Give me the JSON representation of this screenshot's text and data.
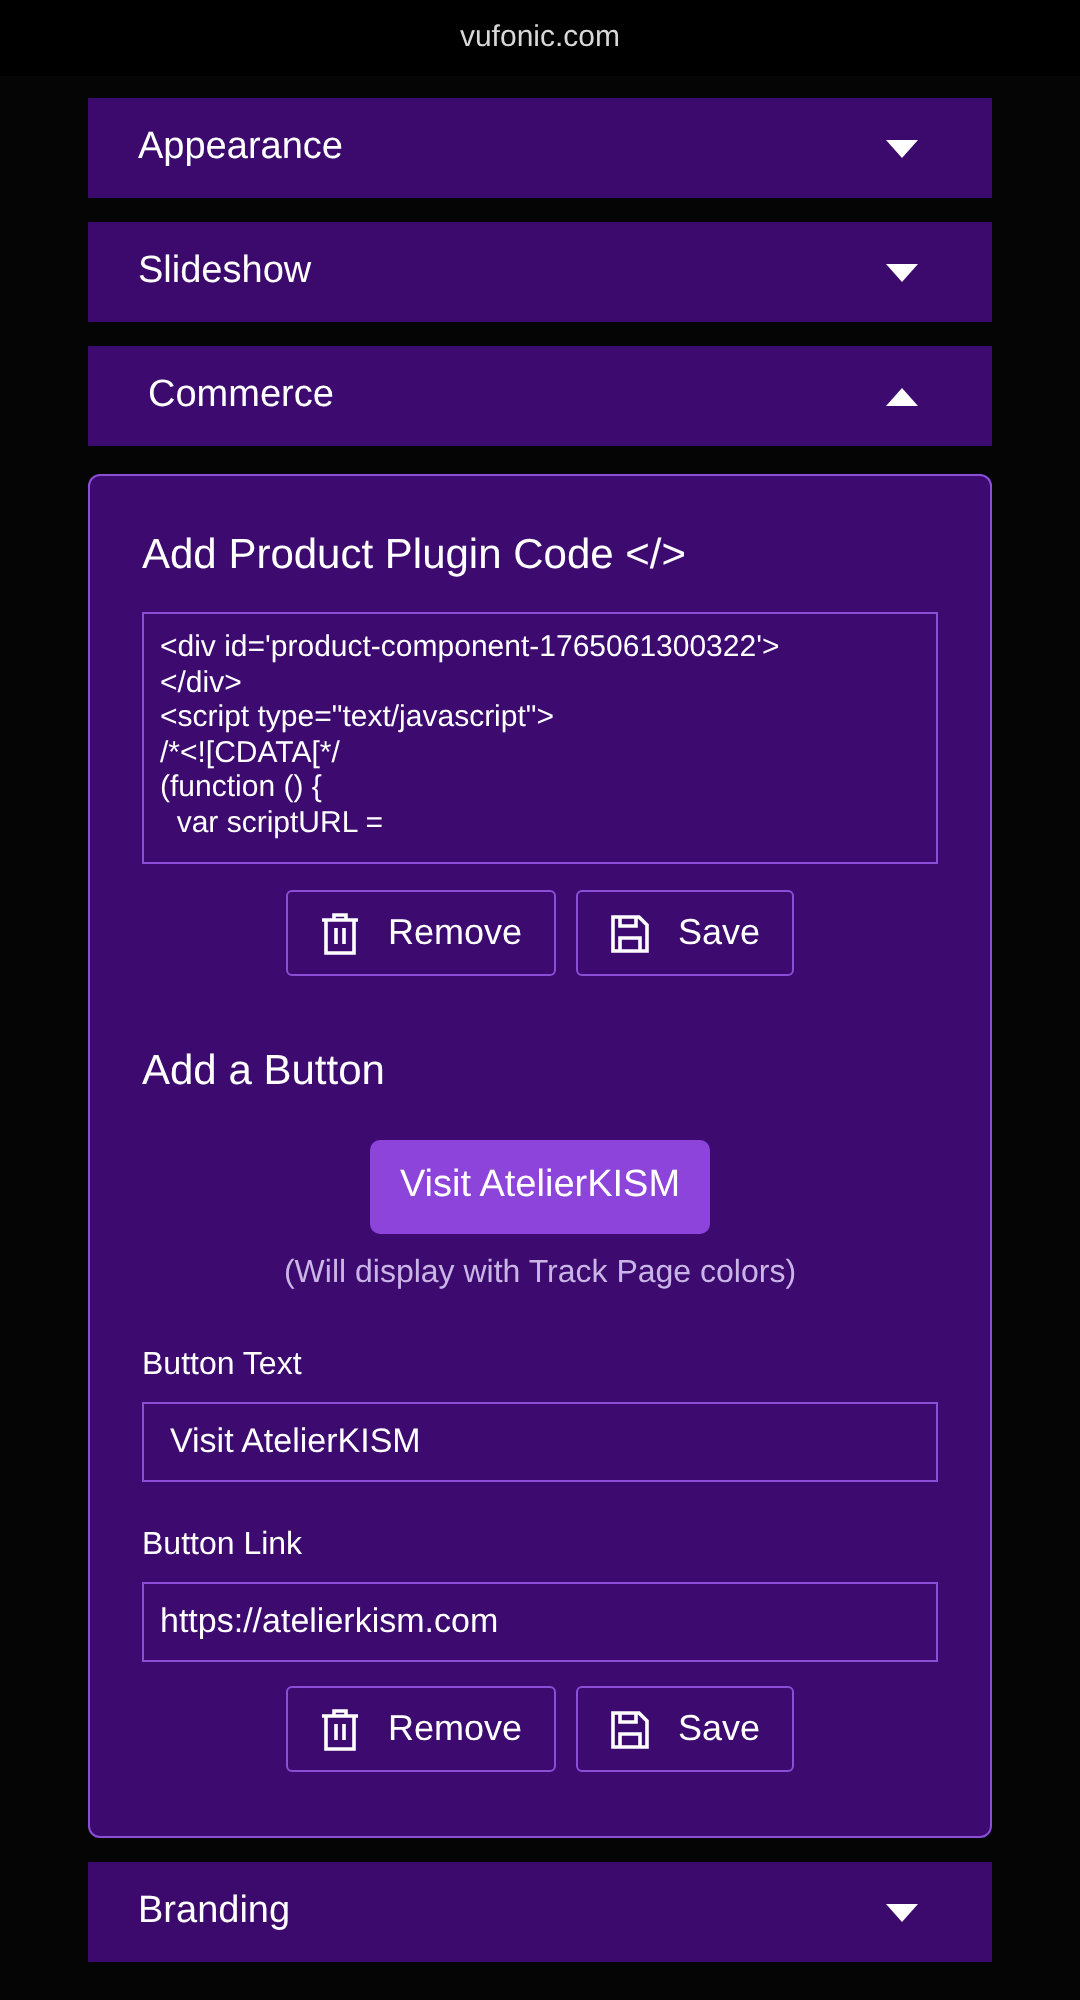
{
  "address_bar": {
    "url": "vufonic.com"
  },
  "sections": [
    {
      "title": "Appearance",
      "expanded": false
    },
    {
      "title": "Slideshow",
      "expanded": false
    },
    {
      "title": "Commerce",
      "expanded": true
    },
    {
      "title": "Branding",
      "expanded": false
    }
  ],
  "commerce_panel": {
    "plugin": {
      "heading": "Add Product Plugin Code </>",
      "code_lines": [
        "<div id='product-component-1765061300322'>",
        "</div>",
        "<script type=\"text/javascript\">",
        "/*<![CDATA[*/",
        "(function () {",
        "  var scriptURL ="
      ],
      "buttons": [
        "Remove",
        "Save"
      ]
    },
    "button_section": {
      "heading": "Add a Button",
      "preview_button": "Visit AtelierKISM",
      "note": "(Will display with Track Page colors)",
      "fields": [
        {
          "label": "Button Text",
          "value": "Visit AtelierKISM"
        },
        {
          "label": "Button Link",
          "value": "https://atelierkism.com"
        }
      ],
      "buttons": [
        "Remove",
        "Save"
      ]
    }
  }
}
